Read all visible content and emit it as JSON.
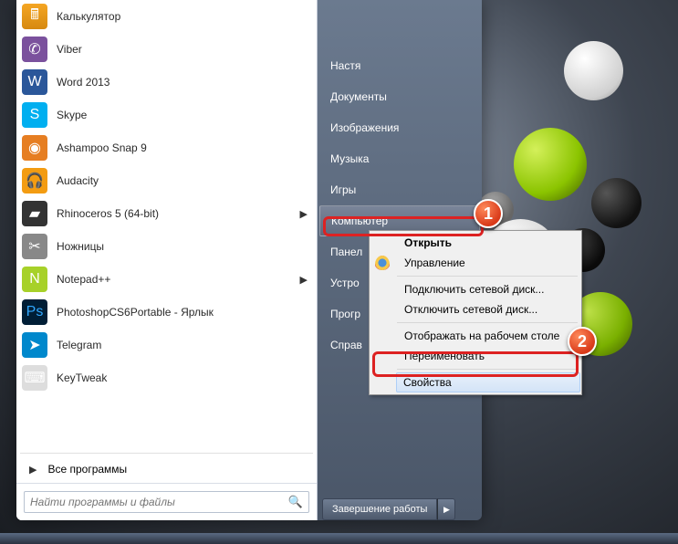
{
  "programs": [
    {
      "label": "Калькулятор",
      "icon": "calc",
      "arrow": false
    },
    {
      "label": "Viber",
      "icon": "viber",
      "arrow": false
    },
    {
      "label": "Word 2013",
      "icon": "word",
      "arrow": false
    },
    {
      "label": "Skype",
      "icon": "skype",
      "arrow": false
    },
    {
      "label": "Ashampoo Snap 9",
      "icon": "snap",
      "arrow": false
    },
    {
      "label": "Audacity",
      "icon": "aud",
      "arrow": false
    },
    {
      "label": "Rhinoceros 5 (64-bit)",
      "icon": "rhino",
      "arrow": true
    },
    {
      "label": "Ножницы",
      "icon": "sci",
      "arrow": false
    },
    {
      "label": "Notepad++",
      "icon": "npp",
      "arrow": true
    },
    {
      "label": "PhotoshopCS6Portable - Ярлык",
      "icon": "ps",
      "arrow": false
    },
    {
      "label": "Telegram",
      "icon": "tg",
      "arrow": false
    },
    {
      "label": "KeyTweak",
      "icon": "kt",
      "arrow": false
    }
  ],
  "all_programs": "Все программы",
  "search_placeholder": "Найти программы и файлы",
  "side_items": [
    {
      "label": "Настя",
      "name": "user"
    },
    {
      "label": "Документы",
      "name": "documents"
    },
    {
      "label": "Изображения",
      "name": "pictures"
    },
    {
      "label": "Музыка",
      "name": "music"
    },
    {
      "label": "Игры",
      "name": "games"
    },
    {
      "label": "Компьютер",
      "name": "computer",
      "highlighted": true
    },
    {
      "label": "Панел",
      "name": "control-panel"
    },
    {
      "label": "Устро",
      "name": "devices"
    },
    {
      "label": "Прогр",
      "name": "default-programs"
    },
    {
      "label": "Справ",
      "name": "help"
    }
  ],
  "shutdown": {
    "label": "Завершение работы"
  },
  "context_menu": {
    "open": "Открыть",
    "manage": "Управление",
    "map_drive": "Подключить сетевой диск...",
    "disconnect_drive": "Отключить сетевой диск...",
    "show_desktop": "Отображать на рабочем столе",
    "rename": "Переименовать",
    "properties": "Свойства"
  },
  "markers": {
    "one": "1",
    "two": "2"
  },
  "icon_glyphs": {
    "calc": "🖩",
    "viber": "✆",
    "word": "W",
    "skype": "S",
    "snap": "◉",
    "aud": "🎧",
    "rhino": "▰",
    "sci": "✂",
    "npp": "N",
    "ps": "Ps",
    "tg": "➤",
    "kt": "⌨"
  }
}
